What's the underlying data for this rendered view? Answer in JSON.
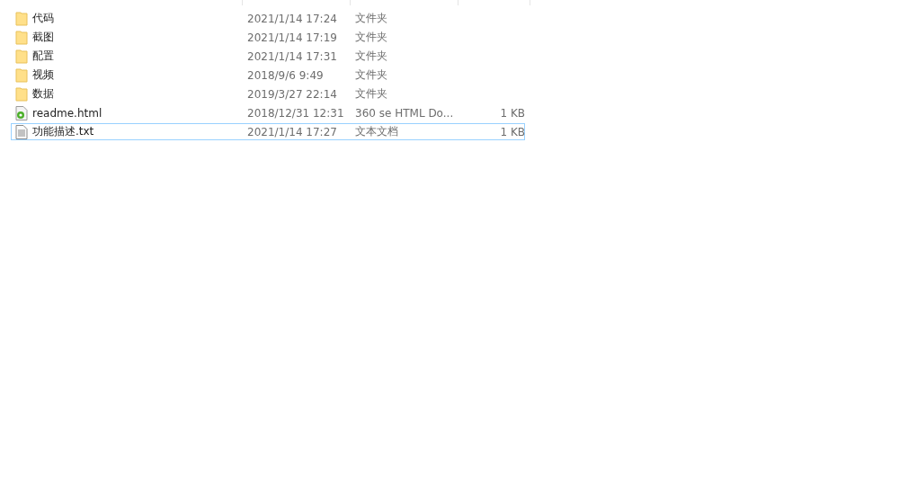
{
  "files": [
    {
      "name": "代码",
      "modified": "2021/1/14 17:24",
      "type": "文件夹",
      "kind": "folder",
      "focused": false
    },
    {
      "name": "截图",
      "modified": "2021/1/14 17:19",
      "type": "文件夹",
      "kind": "folder",
      "focused": false
    },
    {
      "name": "配置",
      "modified": "2021/1/14 17:31",
      "type": "文件夹",
      "kind": "folder",
      "focused": false
    },
    {
      "name": "视频",
      "modified": "2018/9/6 9:49",
      "type": "文件夹",
      "kind": "folder",
      "focused": false
    },
    {
      "name": "数据",
      "modified": "2019/3/27 22:14",
      "type": "文件夹",
      "kind": "folder",
      "focused": false
    },
    {
      "name": "readme.html",
      "modified": "2018/12/31 12:31",
      "type": "360 se HTML Do...",
      "size": "1 KB",
      "kind": "html",
      "focused": false
    },
    {
      "name": "功能描述.txt",
      "modified": "2021/1/14 17:27",
      "type": "文本文档",
      "size": "1 KB",
      "kind": "text",
      "focused": true
    }
  ]
}
